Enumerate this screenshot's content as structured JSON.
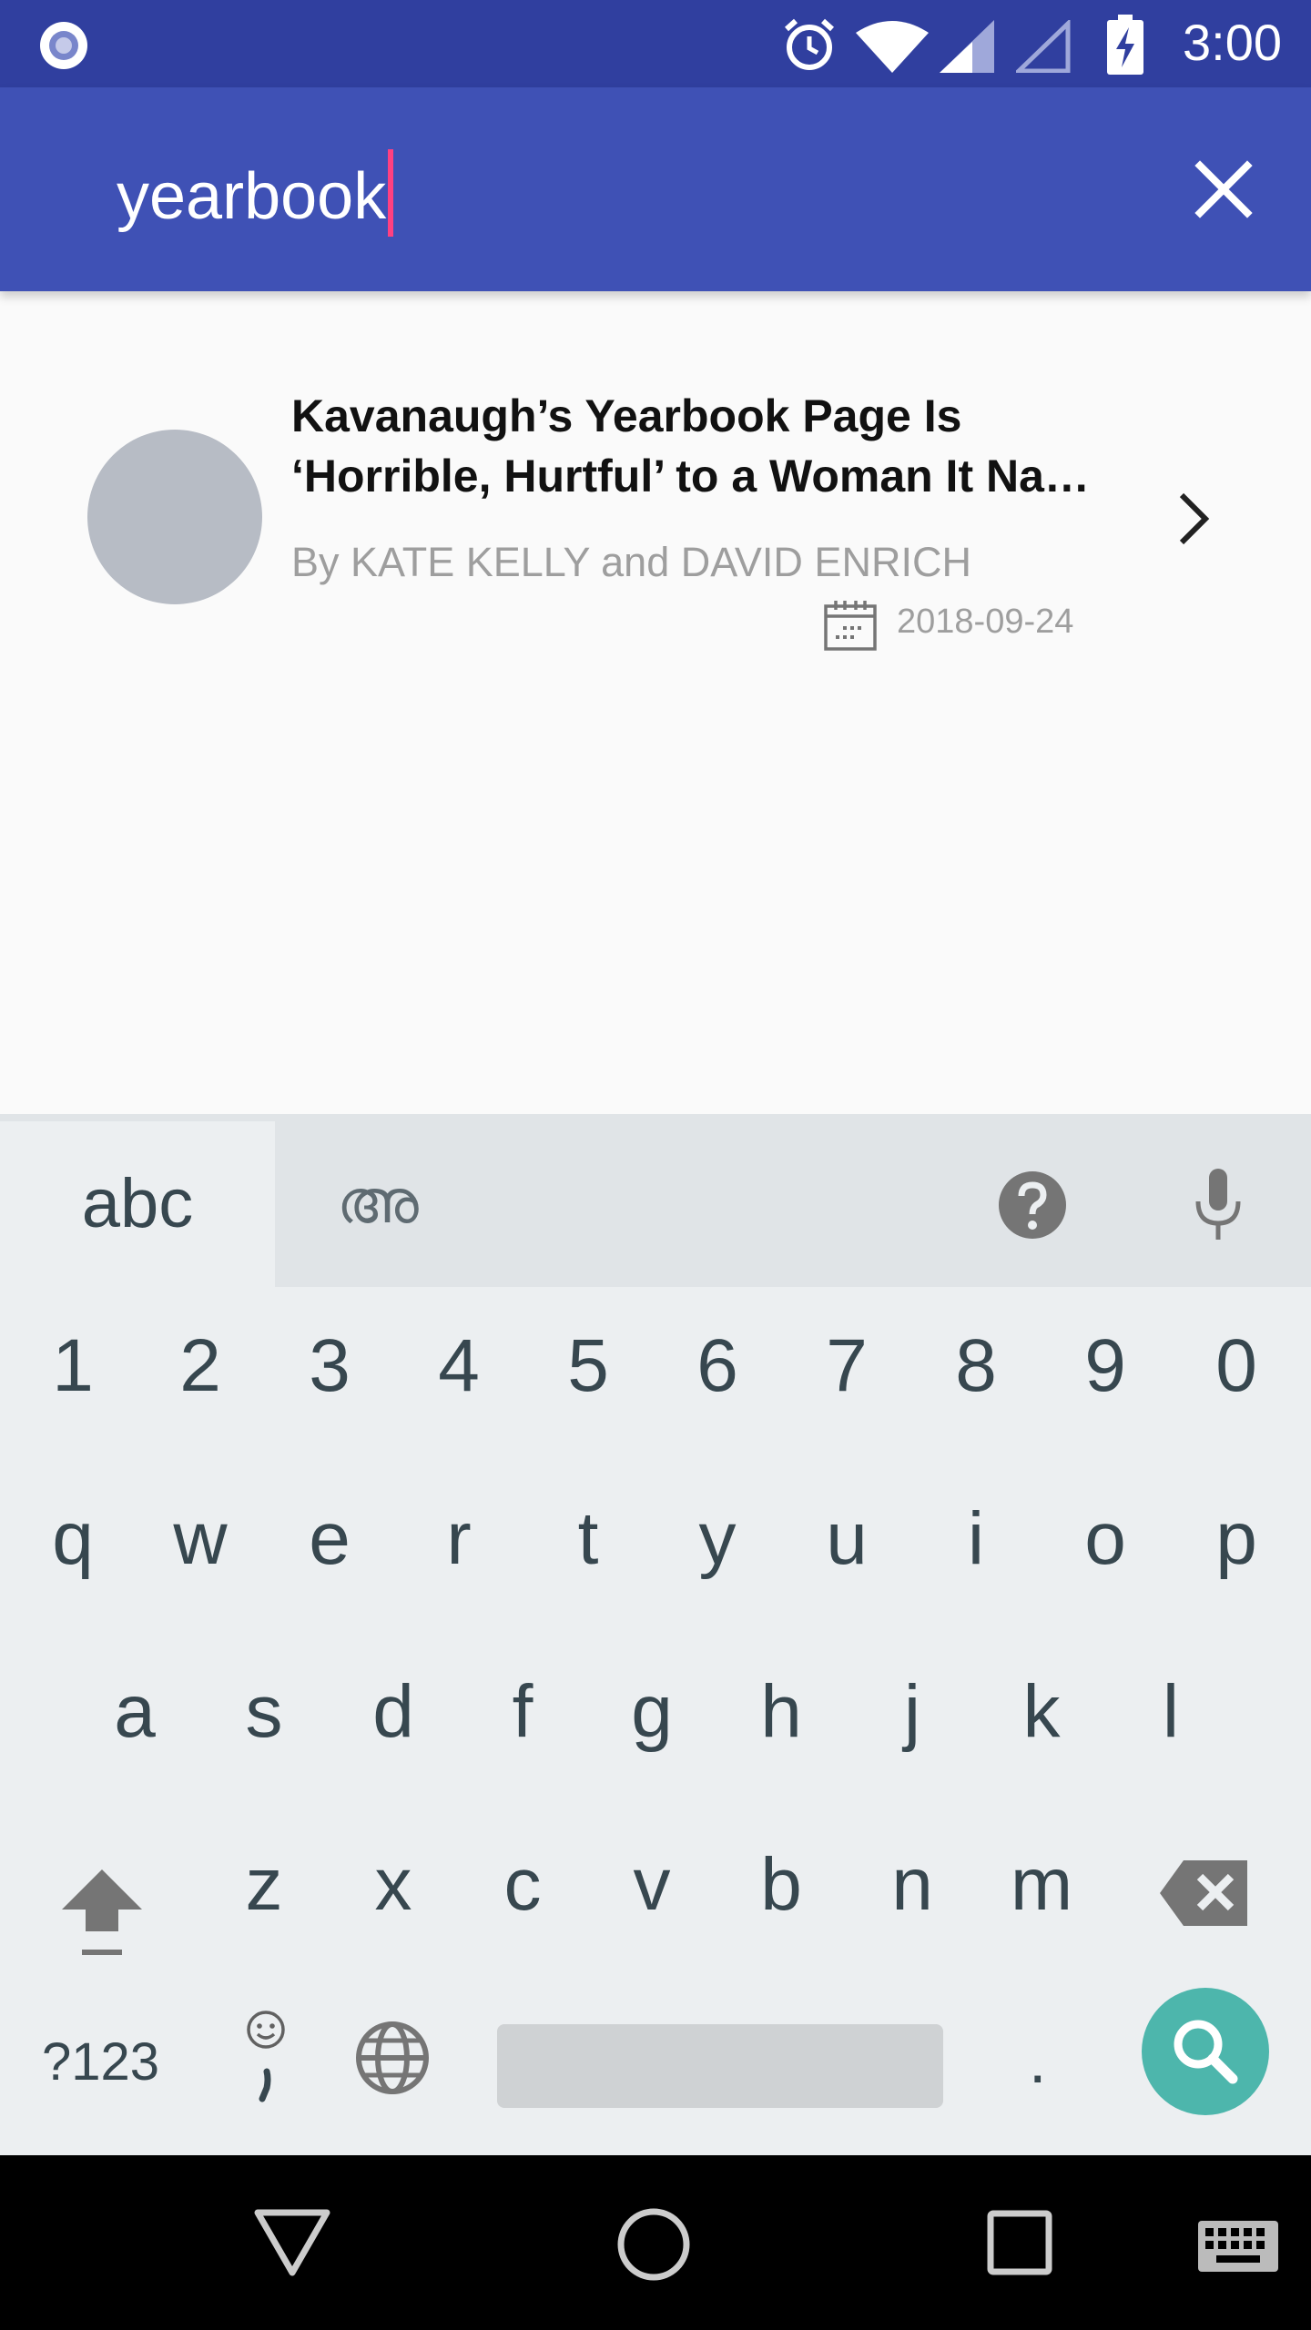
{
  "status_bar": {
    "time": "3:00"
  },
  "search": {
    "query": "yearbook"
  },
  "results": [
    {
      "title_line1": "Kavanaugh’s Yearbook Page Is",
      "title_line2": "‘Horrible, Hurtful’ to a Woman It Na…",
      "byline": "By KATE KELLY and DAVID ENRICH",
      "date": "2018-09-24"
    }
  ],
  "keyboard": {
    "tab_abc": "abc",
    "tab_malayalam": "അ",
    "row_numbers": [
      "1",
      "2",
      "3",
      "4",
      "5",
      "6",
      "7",
      "8",
      "9",
      "0"
    ],
    "row_q": [
      "q",
      "w",
      "e",
      "r",
      "t",
      "y",
      "u",
      "i",
      "o",
      "p"
    ],
    "row_a": [
      "a",
      "s",
      "d",
      "f",
      "g",
      "h",
      "j",
      "k",
      "l"
    ],
    "row_z": [
      "z",
      "x",
      "c",
      "v",
      "b",
      "n",
      "m"
    ],
    "symbols_toggle": "?123",
    "period": "."
  },
  "colors": {
    "status_bar": "#303f9f",
    "app_bar": "#3f51b5",
    "accent": "#ff4081",
    "search_fab": "#4db6ac"
  }
}
